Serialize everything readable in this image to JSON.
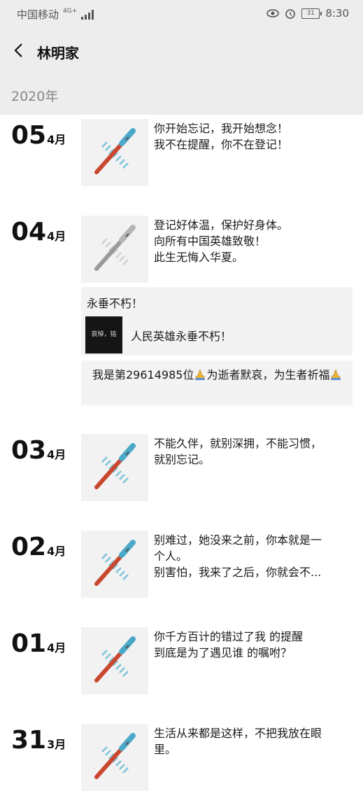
{
  "status_bar": {
    "carrier": "中国移动",
    "network": "4G+",
    "battery": "31",
    "time": "8:30"
  },
  "header": {
    "title": "林明家"
  },
  "year_label": "2020年",
  "month_suffix": "月",
  "posts": [
    {
      "day": "05",
      "month": "4",
      "thumb_style": "blue",
      "lines": [
        "你开始忘记，我开始想念！",
        "我不在提醒，你不在登记！"
      ]
    },
    {
      "day": "04",
      "month": "4",
      "thumb_style": "gray",
      "lines": [
        "登记好体温，保护好身体。",
        "向所有中国英雄致敬！",
        "此生无悔入华夏。"
      ],
      "share": {
        "title": "永垂不朽！",
        "image_text": "哀悼，铭记。",
        "text": "人民英雄永垂不朽！"
      },
      "share2": {
        "text_before": "我是第29614985位",
        "text_middle": "为逝者默哀，为生者祈福",
        "emoji": "praying-hands-emoji"
      }
    },
    {
      "day": "03",
      "month": "4",
      "thumb_style": "blue",
      "lines": [
        "不能久伴，就别深拥，不能习惯，",
        "就别忘记。"
      ]
    },
    {
      "day": "02",
      "month": "4",
      "thumb_style": "blue",
      "lines": [
        "别难过，她没来之前，你本就是一",
        "个人。",
        "别害怕，我来了之后，你就会不..."
      ]
    },
    {
      "day": "01",
      "month": "4",
      "thumb_style": "blue",
      "lines": [
        "你千方百计的错过了我 的提醒",
        "到底是为了遇见谁 的嘱咐？"
      ]
    },
    {
      "day": "31",
      "month": "3",
      "thumb_style": "blue",
      "lines": [
        "生活从来都是这样，不把我放在眼",
        "里。"
      ]
    }
  ],
  "colors": {
    "header_bg": "#ededed",
    "thermo_red": "#c8472e",
    "thermo_blue": "#4aa8c8",
    "thermo_gray": "#9a9a9a"
  }
}
